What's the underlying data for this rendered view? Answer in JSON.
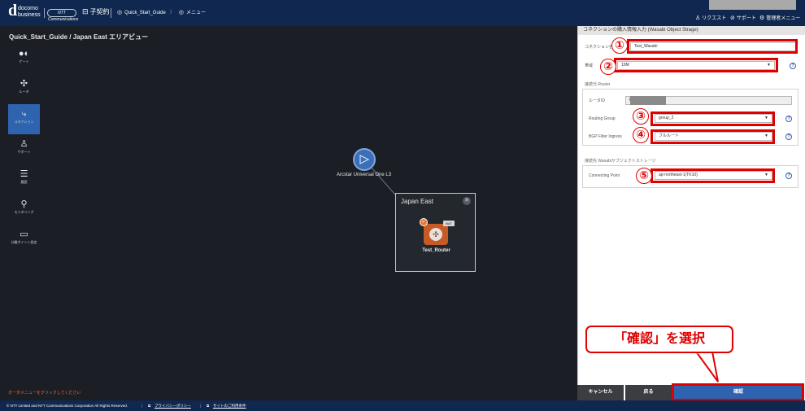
{
  "header": {
    "logo_mark": "d",
    "logo_line1": "docomo",
    "logo_line2": "business",
    "ntt_logo_text": "NTT Communications",
    "contract_label": "子契約",
    "breadcrumb_project": "Quick_Start_Guide",
    "breadcrumb_menu": "メニュー",
    "menu_request": "リクエスト",
    "menu_support": "サポート",
    "menu_admin": "管理者メニュー"
  },
  "canvas": {
    "title": "Quick_Start_Guide / Japan East エリアビュー",
    "sidemenu": [
      {
        "label": "ゲート",
        "icon": "toggle-icon"
      },
      {
        "label": "ルータ",
        "icon": "router-icon"
      },
      {
        "label": "コネクション",
        "icon": "connection-icon"
      },
      {
        "label": "サポート",
        "icon": "support-icon"
      },
      {
        "label": "履歴",
        "icon": "history-icon"
      },
      {
        "label": "モニタリング",
        "icon": "monitoring-icon"
      },
      {
        "label": "分離ポイント設定",
        "icon": "monitor-icon"
      }
    ],
    "gateway_label": "Arcstar Universal One L3",
    "zone_title": "Japan East",
    "router_label": "Test_Router",
    "nat_badge": "NAT",
    "order_message": "オーダメニューをクリックしてください"
  },
  "panel": {
    "title": "コネクションの購入情報入力 (Wasabi Object Strage)",
    "connection_name_label": "コネクション名",
    "connection_name_value": "Test_Wasabi",
    "bandwidth_label": "帯域",
    "bandwidth_value": "10M",
    "source_section": "接続元 Router",
    "router_id_label": "ルータID",
    "router_id_value": "F",
    "routing_group_label": "Routing Group",
    "routing_group_value": "group_2",
    "bgp_filter_label": "BGP Filter Ingress",
    "bgp_filter_value": "フルルート",
    "dest_section": "接続先 Wasabiサブジェクトストレージ",
    "connecting_point_label": "Connecting Point",
    "connecting_point_value": "ap-northeast-1(TK10)",
    "annotations": [
      "①",
      "②",
      "③",
      "④",
      "⑤"
    ],
    "callout": "「確認」を選択"
  },
  "buttons": {
    "cancel": "キャンセル",
    "back": "戻る",
    "confirm": "確認"
  },
  "footer": {
    "copyright": "© NTT Limited and NTT Communications Corporation All Rights Reserved.",
    "privacy": "プライバシーポリシー",
    "terms": "サイトのご利用条件"
  },
  "colors": {
    "header_bg": "#10284f",
    "canvas_bg": "#1b1e24",
    "accent_blue": "#2e63b0",
    "annotation_red": "#e10000",
    "router_orange": "#c85a25"
  }
}
